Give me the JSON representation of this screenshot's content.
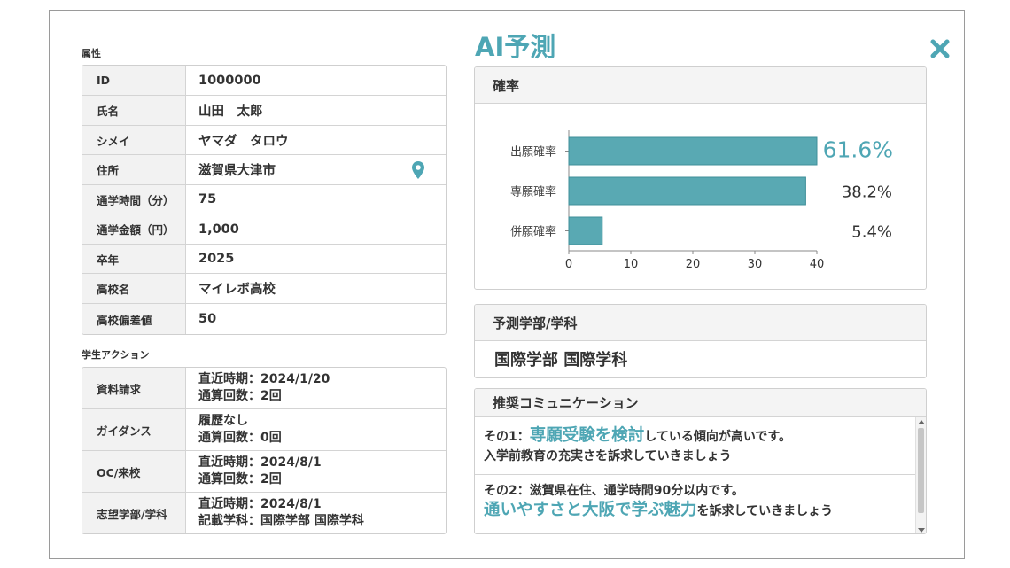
{
  "attributes": {
    "section_label": "属性",
    "rows": [
      {
        "key": "ID",
        "value": "1000000"
      },
      {
        "key": "氏名",
        "value": "山田　太郎"
      },
      {
        "key": "シメイ",
        "value": "ヤマダ　タロウ"
      },
      {
        "key": "住所",
        "value": "滋賀県大津市"
      },
      {
        "key": "通学時間（分）",
        "value": "75"
      },
      {
        "key": "通学金額（円）",
        "value": "1,000"
      },
      {
        "key": "卒年",
        "value": "2025"
      },
      {
        "key": "高校名",
        "value": "マイレボ高校"
      },
      {
        "key": "高校偏差値",
        "value": "50"
      }
    ]
  },
  "actions": {
    "section_label": "学生アクション",
    "rows": [
      {
        "key": "資料請求",
        "line1": "直近時期：2024/1/20",
        "line2": "通算回数：2回"
      },
      {
        "key": "ガイダンス",
        "line1": "履歴なし",
        "line2": "通算回数：0回"
      },
      {
        "key": "OC/来校",
        "line1": "直近時期：2024/8/1",
        "line2": "通算回数：2回"
      },
      {
        "key": "志望学部/学科",
        "line1": "直近時期：2024/8/1",
        "line2": "記載学科：国際学部 国際学科"
      }
    ]
  },
  "title": "AI予測",
  "probability_panel": {
    "heading": "確率"
  },
  "chart_data": {
    "type": "bar",
    "orientation": "horizontal",
    "categories": [
      "出願確率",
      "専願確率",
      "併願確率"
    ],
    "values": [
      61.6,
      38.2,
      5.4
    ],
    "value_labels": [
      "61.6%",
      "38.2%",
      "5.4%"
    ],
    "xticks": [
      "0",
      "10",
      "20",
      "30",
      "40"
    ],
    "xlim": [
      0,
      40
    ],
    "bar_color": "#59a9b3",
    "highlight_color": "#4ea6b4"
  },
  "prediction_panel": {
    "heading": "予測学部/学科",
    "value": "国際学部 国際学科"
  },
  "communication_panel": {
    "heading": "推奨コミュニケーション",
    "item1": {
      "prefix": "その1：",
      "highlight": "専願受験を検討",
      "suffix": "している傾向が高いです。",
      "line2": "入学前教育の充実さを訴求していきましょう"
    },
    "item2": {
      "line1": "その2：滋賀県在住、通学時間90分以内です。",
      "highlight": "通いやすさと大阪で学ぶ魅力",
      "suffix": "を訴求していきましょう"
    }
  },
  "colors": {
    "accent": "#4ea6b4",
    "bar": "#59a9b3"
  },
  "icons": {
    "close": "close-x-icon",
    "location": "map-pin-icon"
  }
}
